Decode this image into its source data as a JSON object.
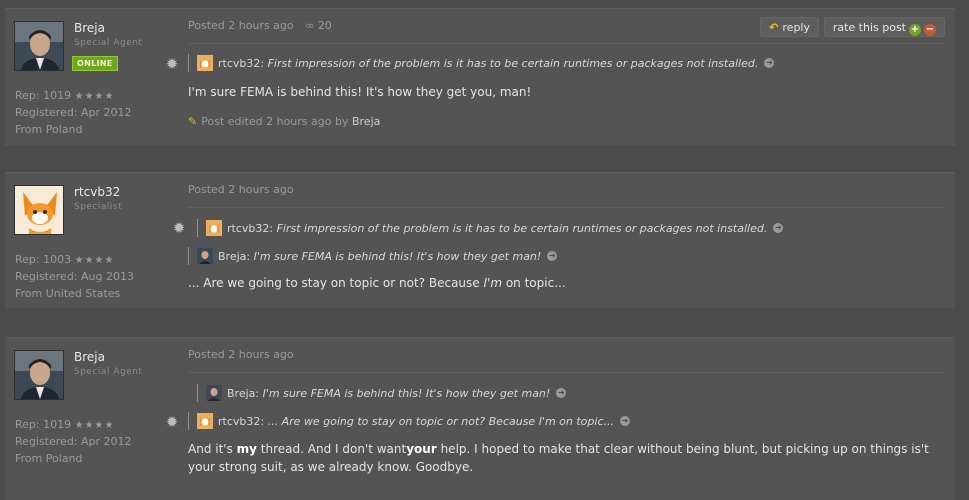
{
  "posts": [
    {
      "author": {
        "name": "Breja",
        "title": "Special Agent",
        "online": "ONLINE",
        "rep": "Rep: 1019",
        "stars": "★★★★",
        "registered": "Registered: Apr 2012",
        "from": "From Poland"
      },
      "posted": "Posted 2 hours ago",
      "views_icon": "views-icon",
      "views": "20",
      "reply_label": "reply",
      "rate_label": "rate this post",
      "quotes": [
        {
          "user": "rtcvb32:",
          "text": "First impression of the problem is it has to be certain runtimes or packages not installed."
        }
      ],
      "body": "I'm sure FEMA is behind this! It's how they get you, man!",
      "edited_text": "Post edited 2 hours ago by",
      "edited_by": "Breja"
    },
    {
      "author": {
        "name": "rtcvb32",
        "title": "Specialist",
        "rep": "Rep: 1003",
        "stars": "★★★★",
        "registered": "Registered: Aug 2013",
        "from": "From United States"
      },
      "posted": "Posted 2 hours ago",
      "quotes": [
        {
          "user": "rtcvb32:",
          "text": "First impression of the problem is it has to be certain runtimes or packages not installed."
        },
        {
          "user": "Breja:",
          "text": "I'm sure FEMA is behind this! It's how they get man!"
        }
      ],
      "body_pre": "... Are we going to stay on topic or not? Because ",
      "body_em": "I'm",
      "body_post": " on topic..."
    },
    {
      "author": {
        "name": "Breja",
        "title": "Special Agent",
        "rep": "Rep: 1019",
        "stars": "★★★★",
        "registered": "Registered: Apr 2012",
        "from": "From Poland"
      },
      "posted": "Posted 2 hours ago",
      "quotes": [
        {
          "user": "Breja:",
          "text": "I'm sure FEMA is behind this! It's how they get man!"
        },
        {
          "user": "rtcvb32:",
          "text": "... Are we going to stay on topic or not? Because I'm on topic..."
        }
      ],
      "body_1": "And it's ",
      "body_b1": "my",
      "body_2": " thread. And I don't want",
      "body_b2": "your",
      "body_3": " help. I hoped to make that clear without being blunt, but picking up on things is't your strong suit, as we already know. Goodbye."
    }
  ]
}
